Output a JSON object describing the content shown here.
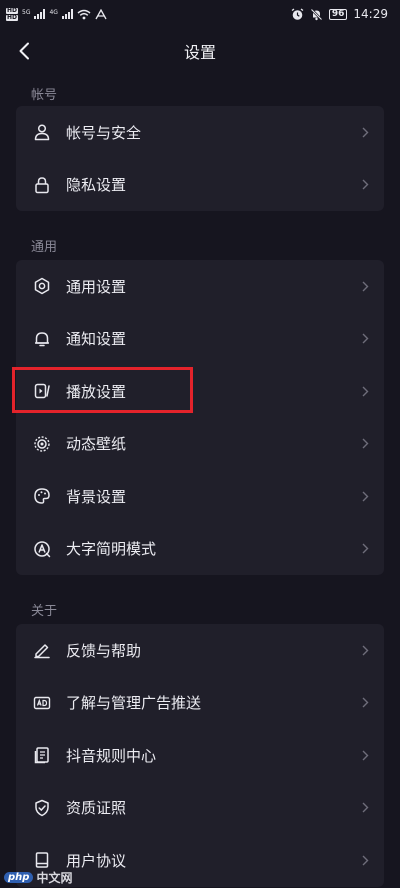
{
  "status_bar": {
    "hd_tags": [
      "HD",
      "HD"
    ],
    "network_left": "5G",
    "network_mid": "4G",
    "battery": "96",
    "time": "14:29"
  },
  "header": {
    "title": "设置"
  },
  "sections": [
    {
      "title": "帐号",
      "items": [
        {
          "label": "帐号与安全",
          "icon": "user-icon"
        },
        {
          "label": "隐私设置",
          "icon": "lock-icon"
        }
      ]
    },
    {
      "title": "通用",
      "items": [
        {
          "label": "通用设置",
          "icon": "gear-icon"
        },
        {
          "label": "通知设置",
          "icon": "bell-icon"
        },
        {
          "label": "播放设置",
          "icon": "play-settings-icon"
        },
        {
          "label": "动态壁纸",
          "icon": "wallpaper-icon"
        },
        {
          "label": "背景设置",
          "icon": "palette-icon"
        },
        {
          "label": "大字简明模式",
          "icon": "large-text-icon"
        }
      ]
    },
    {
      "title": "关于",
      "items": [
        {
          "label": "反馈与帮助",
          "icon": "pencil-icon"
        },
        {
          "label": "了解与管理广告推送",
          "icon": "ad-icon"
        },
        {
          "label": "抖音规则中心",
          "icon": "rules-doc-icon"
        },
        {
          "label": "资质证照",
          "icon": "shield-check-icon"
        },
        {
          "label": "用户协议",
          "icon": "book-icon"
        }
      ]
    }
  ],
  "highlighted_item": "播放设置",
  "watermark": {
    "badge": "php",
    "text": "中文网"
  },
  "colors": {
    "background": "#16151f",
    "card": "#201f2a",
    "section_text": "#8a8997",
    "highlight": "#e3232b"
  }
}
